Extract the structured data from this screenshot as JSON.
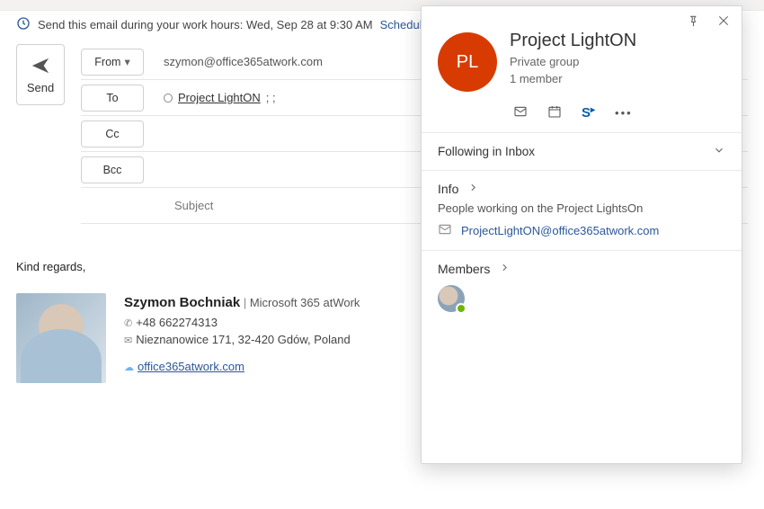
{
  "suggestion": {
    "text": "Send this email during your work hours: Wed, Sep 28 at 9:30 AM",
    "link": "Schedule sen"
  },
  "send_label": "Send",
  "fields": {
    "from_label": "From",
    "from_value": "szymon@office365atwork.com",
    "to_label": "To",
    "to_recipient": "Project LightON",
    "to_suffix": "; ;",
    "cc_label": "Cc",
    "bcc_label": "Bcc"
  },
  "subject_label": "Subject",
  "body": {
    "regards": "Kind regards,",
    "sig_name": "Szymon Bochniak",
    "sig_org": "Microsoft 365 atWork",
    "sig_phone": "+48 662274313",
    "sig_address": "Nieznanowice 171, 32-420 Gdów, Poland",
    "sig_link": "office365atwork.com"
  },
  "card": {
    "initials": "PL",
    "title": "Project LightON",
    "type": "Private group",
    "members_count": "1 member",
    "following_label": "Following in Inbox",
    "info_label": "Info",
    "info_desc": "People working on the Project LightsOn",
    "info_email": "ProjectLightON@office365atwork.com",
    "members_label": "Members"
  }
}
